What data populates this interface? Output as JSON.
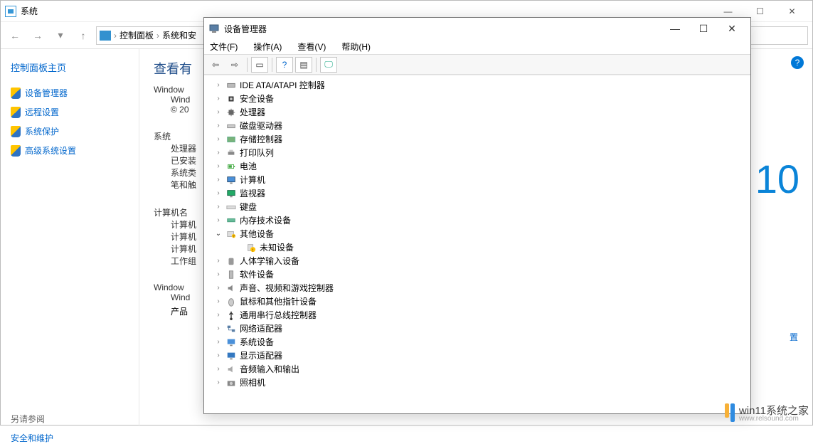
{
  "parent": {
    "title": "系统",
    "breadcrumb": [
      "控制面板",
      "系统和安"
    ],
    "help": "?"
  },
  "sidebar": {
    "title": "控制面板主页",
    "links": [
      "设备管理器",
      "远程设置",
      "系统保护",
      "高级系统设置"
    ],
    "see_also_label": "另请参阅",
    "see_also_link": "安全和维护"
  },
  "content": {
    "h1": "查看有",
    "win_label": "Window",
    "win_sub1": "Wind",
    "win_sub2": "© 20",
    "sys_label": "系统",
    "rows": [
      "处理器",
      "已安装",
      "系统类",
      "笔和触"
    ],
    "comp_label": "计算机名",
    "comp_rows": [
      "计算机",
      "计算机",
      "计算机",
      "工作组"
    ],
    "act_label": "Window",
    "act_sub": "Wind",
    "prod": "产品",
    "big": "10",
    "set_link": "置"
  },
  "device_manager": {
    "title": "设备管理器",
    "menu": [
      "文件(F)",
      "操作(A)",
      "查看(V)",
      "帮助(H)"
    ],
    "tree": [
      {
        "label": "IDE ATA/ATAPI 控制器",
        "icon": "ide"
      },
      {
        "label": "安全设备",
        "icon": "chip"
      },
      {
        "label": "处理器",
        "icon": "cpu"
      },
      {
        "label": "磁盘驱动器",
        "icon": "disk"
      },
      {
        "label": "存储控制器",
        "icon": "storage"
      },
      {
        "label": "打印队列",
        "icon": "printer"
      },
      {
        "label": "电池",
        "icon": "battery"
      },
      {
        "label": "计算机",
        "icon": "monitor"
      },
      {
        "label": "监视器",
        "icon": "display"
      },
      {
        "label": "键盘",
        "icon": "keyboard"
      },
      {
        "label": "内存技术设备",
        "icon": "memory"
      },
      {
        "label": "其他设备",
        "icon": "other",
        "expanded": true,
        "children": [
          {
            "label": "未知设备",
            "icon": "unknown"
          }
        ]
      },
      {
        "label": "人体学输入设备",
        "icon": "hid"
      },
      {
        "label": "软件设备",
        "icon": "software"
      },
      {
        "label": "声音、视频和游戏控制器",
        "icon": "sound"
      },
      {
        "label": "鼠标和其他指针设备",
        "icon": "mouse"
      },
      {
        "label": "通用串行总线控制器",
        "icon": "usb"
      },
      {
        "label": "网络适配器",
        "icon": "network"
      },
      {
        "label": "系统设备",
        "icon": "system"
      },
      {
        "label": "显示适配器",
        "icon": "gpu"
      },
      {
        "label": "音频输入和输出",
        "icon": "audio"
      },
      {
        "label": "照相机",
        "icon": "camera"
      }
    ]
  },
  "watermark": {
    "main": "win11系统之家",
    "sub": "www.relsound.com"
  }
}
